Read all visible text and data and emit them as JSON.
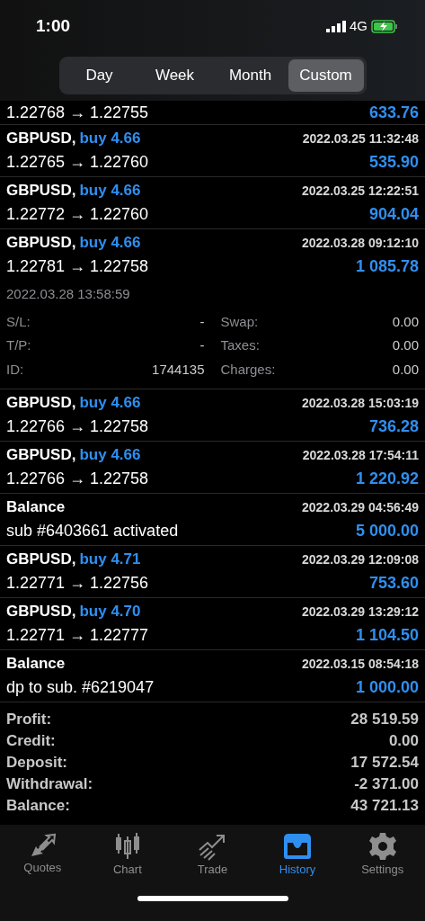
{
  "status_bar": {
    "time": "1:00",
    "network": "4G"
  },
  "periods": [
    {
      "label": "Day",
      "selected": false
    },
    {
      "label": "Week",
      "selected": false
    },
    {
      "label": "Month",
      "selected": false
    },
    {
      "label": "Custom",
      "selected": true
    }
  ],
  "deals": [
    {
      "kind": "partial",
      "prices": "1.22768 → 1.22755",
      "amount": "633.76"
    },
    {
      "kind": "trade",
      "symbol": "GBPUSD,",
      "side": "buy 4.66",
      "time": "2022.03.25 11:32:48",
      "prices": "1.22765 → 1.22760",
      "amount": "535.90"
    },
    {
      "kind": "trade",
      "symbol": "GBPUSD,",
      "side": "buy 4.66",
      "time": "2022.03.25 12:22:51",
      "prices": "1.22772 → 1.22760",
      "amount": "904.04"
    },
    {
      "kind": "trade",
      "symbol": "GBPUSD,",
      "side": "buy 4.66",
      "time": "2022.03.28 09:12:10",
      "prices": "1.22781 → 1.22758",
      "amount": "1 085.78",
      "details": {
        "close_time": "2022.03.28 13:58:59",
        "fields": [
          {
            "label": "S/L:",
            "value": "-"
          },
          {
            "label": "Swap:",
            "value": "0.00"
          },
          {
            "label": "T/P:",
            "value": "-"
          },
          {
            "label": "Taxes:",
            "value": "0.00"
          },
          {
            "label": "ID:",
            "value": "1744135"
          },
          {
            "label": "Charges:",
            "value": "0.00"
          }
        ]
      }
    },
    {
      "kind": "trade",
      "symbol": "GBPUSD,",
      "side": "buy 4.66",
      "time": "2022.03.28 15:03:19",
      "prices": "1.22766 → 1.22758",
      "amount": "736.28"
    },
    {
      "kind": "trade",
      "symbol": "GBPUSD,",
      "side": "buy 4.66",
      "time": "2022.03.28 17:54:11",
      "prices": "1.22766 → 1.22758",
      "amount": "1 220.92"
    },
    {
      "kind": "balance",
      "symbol": "Balance",
      "time": "2022.03.29 04:56:49",
      "prices": "sub #6403661 activated",
      "amount": "5 000.00"
    },
    {
      "kind": "trade",
      "symbol": "GBPUSD,",
      "side": "buy 4.71",
      "time": "2022.03.29 12:09:08",
      "prices": "1.22771 → 1.22756",
      "amount": "753.60"
    },
    {
      "kind": "trade",
      "symbol": "GBPUSD,",
      "side": "buy 4.70",
      "time": "2022.03.29 13:29:12",
      "prices": "1.22771 → 1.22777",
      "amount": "1 104.50"
    },
    {
      "kind": "balance",
      "symbol": "Balance",
      "time": "2022.03.15 08:54:18",
      "prices": "dp to sub. #6219047",
      "amount": "1 000.00"
    }
  ],
  "summary": [
    {
      "label": "Profit:",
      "value": "28 519.59"
    },
    {
      "label": "Credit:",
      "value": "0.00"
    },
    {
      "label": "Deposit:",
      "value": "17 572.54"
    },
    {
      "label": "Withdrawal:",
      "value": "-2 371.00"
    },
    {
      "label": "Balance:",
      "value": "43 721.13"
    }
  ],
  "tabs": [
    {
      "kind": "quotes",
      "label": "Quotes",
      "selected": false
    },
    {
      "kind": "chart",
      "label": "Chart",
      "selected": false
    },
    {
      "kind": "trade",
      "label": "Trade",
      "selected": false
    },
    {
      "kind": "history",
      "label": "History",
      "selected": true
    },
    {
      "kind": "settings",
      "label": "Settings",
      "selected": false
    }
  ]
}
